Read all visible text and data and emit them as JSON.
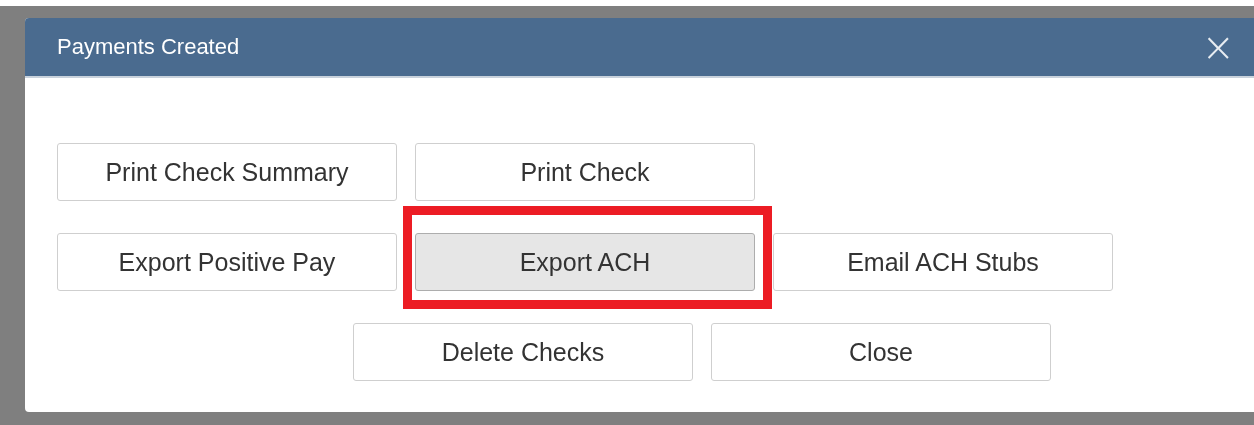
{
  "dialog": {
    "title": "Payments Created",
    "close_label": "×",
    "button_rows": [
      {
        "buttons": [
          {
            "label": "Print Check Summary",
            "highlighted": false
          },
          {
            "label": "Print Check",
            "highlighted": false
          }
        ]
      },
      {
        "buttons": [
          {
            "label": "Export Positive Pay",
            "highlighted": false
          },
          {
            "label": "Export ACH",
            "highlighted": true
          },
          {
            "label": "Email ACH Stubs",
            "highlighted": false
          }
        ]
      },
      {
        "buttons": [
          {
            "label": "Delete Checks",
            "highlighted": false
          },
          {
            "label": "Close",
            "highlighted": false
          }
        ]
      }
    ]
  }
}
